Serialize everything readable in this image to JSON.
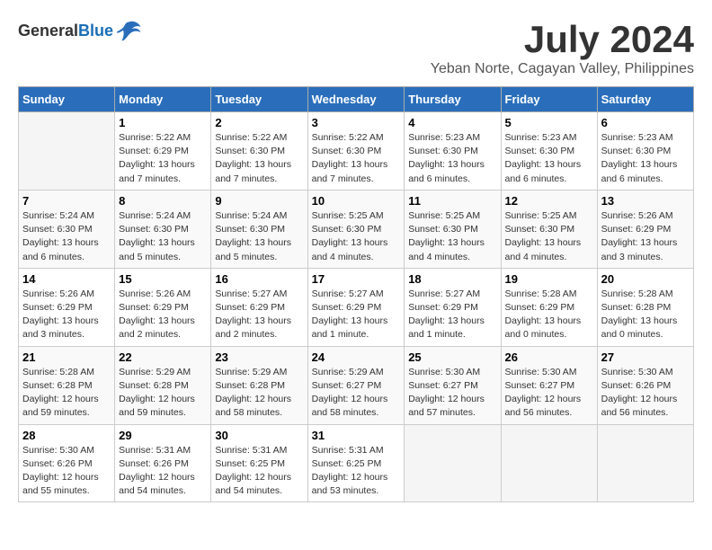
{
  "app": {
    "logo_general": "General",
    "logo_blue": "Blue"
  },
  "title": {
    "month": "July 2024",
    "location": "Yeban Norte, Cagayan Valley, Philippines"
  },
  "calendar": {
    "headers": [
      "Sunday",
      "Monday",
      "Tuesday",
      "Wednesday",
      "Thursday",
      "Friday",
      "Saturday"
    ],
    "weeks": [
      [
        {
          "day": "",
          "sunrise": "",
          "sunset": "",
          "daylight": "",
          "empty": true
        },
        {
          "day": "1",
          "sunrise": "Sunrise: 5:22 AM",
          "sunset": "Sunset: 6:29 PM",
          "daylight": "Daylight: 13 hours and 7 minutes."
        },
        {
          "day": "2",
          "sunrise": "Sunrise: 5:22 AM",
          "sunset": "Sunset: 6:30 PM",
          "daylight": "Daylight: 13 hours and 7 minutes."
        },
        {
          "day": "3",
          "sunrise": "Sunrise: 5:22 AM",
          "sunset": "Sunset: 6:30 PM",
          "daylight": "Daylight: 13 hours and 7 minutes."
        },
        {
          "day": "4",
          "sunrise": "Sunrise: 5:23 AM",
          "sunset": "Sunset: 6:30 PM",
          "daylight": "Daylight: 13 hours and 6 minutes."
        },
        {
          "day": "5",
          "sunrise": "Sunrise: 5:23 AM",
          "sunset": "Sunset: 6:30 PM",
          "daylight": "Daylight: 13 hours and 6 minutes."
        },
        {
          "day": "6",
          "sunrise": "Sunrise: 5:23 AM",
          "sunset": "Sunset: 6:30 PM",
          "daylight": "Daylight: 13 hours and 6 minutes."
        }
      ],
      [
        {
          "day": "7",
          "sunrise": "Sunrise: 5:24 AM",
          "sunset": "Sunset: 6:30 PM",
          "daylight": "Daylight: 13 hours and 6 minutes."
        },
        {
          "day": "8",
          "sunrise": "Sunrise: 5:24 AM",
          "sunset": "Sunset: 6:30 PM",
          "daylight": "Daylight: 13 hours and 5 minutes."
        },
        {
          "day": "9",
          "sunrise": "Sunrise: 5:24 AM",
          "sunset": "Sunset: 6:30 PM",
          "daylight": "Daylight: 13 hours and 5 minutes."
        },
        {
          "day": "10",
          "sunrise": "Sunrise: 5:25 AM",
          "sunset": "Sunset: 6:30 PM",
          "daylight": "Daylight: 13 hours and 4 minutes."
        },
        {
          "day": "11",
          "sunrise": "Sunrise: 5:25 AM",
          "sunset": "Sunset: 6:30 PM",
          "daylight": "Daylight: 13 hours and 4 minutes."
        },
        {
          "day": "12",
          "sunrise": "Sunrise: 5:25 AM",
          "sunset": "Sunset: 6:30 PM",
          "daylight": "Daylight: 13 hours and 4 minutes."
        },
        {
          "day": "13",
          "sunrise": "Sunrise: 5:26 AM",
          "sunset": "Sunset: 6:29 PM",
          "daylight": "Daylight: 13 hours and 3 minutes."
        }
      ],
      [
        {
          "day": "14",
          "sunrise": "Sunrise: 5:26 AM",
          "sunset": "Sunset: 6:29 PM",
          "daylight": "Daylight: 13 hours and 3 minutes."
        },
        {
          "day": "15",
          "sunrise": "Sunrise: 5:26 AM",
          "sunset": "Sunset: 6:29 PM",
          "daylight": "Daylight: 13 hours and 2 minutes."
        },
        {
          "day": "16",
          "sunrise": "Sunrise: 5:27 AM",
          "sunset": "Sunset: 6:29 PM",
          "daylight": "Daylight: 13 hours and 2 minutes."
        },
        {
          "day": "17",
          "sunrise": "Sunrise: 5:27 AM",
          "sunset": "Sunset: 6:29 PM",
          "daylight": "Daylight: 13 hours and 1 minute."
        },
        {
          "day": "18",
          "sunrise": "Sunrise: 5:27 AM",
          "sunset": "Sunset: 6:29 PM",
          "daylight": "Daylight: 13 hours and 1 minute."
        },
        {
          "day": "19",
          "sunrise": "Sunrise: 5:28 AM",
          "sunset": "Sunset: 6:29 PM",
          "daylight": "Daylight: 13 hours and 0 minutes."
        },
        {
          "day": "20",
          "sunrise": "Sunrise: 5:28 AM",
          "sunset": "Sunset: 6:28 PM",
          "daylight": "Daylight: 13 hours and 0 minutes."
        }
      ],
      [
        {
          "day": "21",
          "sunrise": "Sunrise: 5:28 AM",
          "sunset": "Sunset: 6:28 PM",
          "daylight": "Daylight: 12 hours and 59 minutes."
        },
        {
          "day": "22",
          "sunrise": "Sunrise: 5:29 AM",
          "sunset": "Sunset: 6:28 PM",
          "daylight": "Daylight: 12 hours and 59 minutes."
        },
        {
          "day": "23",
          "sunrise": "Sunrise: 5:29 AM",
          "sunset": "Sunset: 6:28 PM",
          "daylight": "Daylight: 12 hours and 58 minutes."
        },
        {
          "day": "24",
          "sunrise": "Sunrise: 5:29 AM",
          "sunset": "Sunset: 6:27 PM",
          "daylight": "Daylight: 12 hours and 58 minutes."
        },
        {
          "day": "25",
          "sunrise": "Sunrise: 5:30 AM",
          "sunset": "Sunset: 6:27 PM",
          "daylight": "Daylight: 12 hours and 57 minutes."
        },
        {
          "day": "26",
          "sunrise": "Sunrise: 5:30 AM",
          "sunset": "Sunset: 6:27 PM",
          "daylight": "Daylight: 12 hours and 56 minutes."
        },
        {
          "day": "27",
          "sunrise": "Sunrise: 5:30 AM",
          "sunset": "Sunset: 6:26 PM",
          "daylight": "Daylight: 12 hours and 56 minutes."
        }
      ],
      [
        {
          "day": "28",
          "sunrise": "Sunrise: 5:30 AM",
          "sunset": "Sunset: 6:26 PM",
          "daylight": "Daylight: 12 hours and 55 minutes."
        },
        {
          "day": "29",
          "sunrise": "Sunrise: 5:31 AM",
          "sunset": "Sunset: 6:26 PM",
          "daylight": "Daylight: 12 hours and 54 minutes."
        },
        {
          "day": "30",
          "sunrise": "Sunrise: 5:31 AM",
          "sunset": "Sunset: 6:25 PM",
          "daylight": "Daylight: 12 hours and 54 minutes."
        },
        {
          "day": "31",
          "sunrise": "Sunrise: 5:31 AM",
          "sunset": "Sunset: 6:25 PM",
          "daylight": "Daylight: 12 hours and 53 minutes."
        },
        {
          "day": "",
          "sunrise": "",
          "sunset": "",
          "daylight": "",
          "empty": true
        },
        {
          "day": "",
          "sunrise": "",
          "sunset": "",
          "daylight": "",
          "empty": true
        },
        {
          "day": "",
          "sunrise": "",
          "sunset": "",
          "daylight": "",
          "empty": true
        }
      ]
    ]
  }
}
